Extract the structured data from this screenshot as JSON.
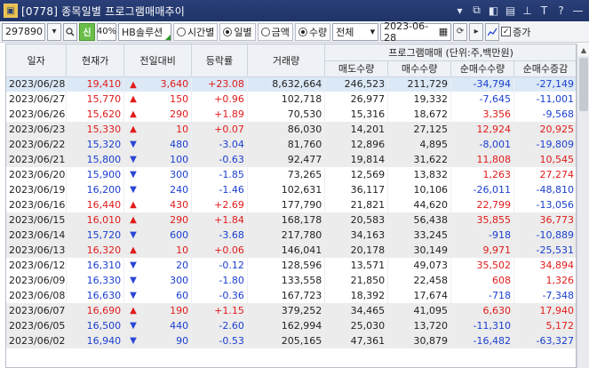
{
  "window": {
    "screen_no": "0778",
    "title": "종목일별 프로그램매매추이"
  },
  "toolbar": {
    "code": "297890",
    "sin_label": "신",
    "margin_rate": "40%",
    "stock_name": "HB솔루션",
    "time_label": "시간별",
    "daily_label": "일별",
    "amount_label": "금액",
    "quantity_label": "수량",
    "market_select": "전체",
    "date": "2023-06-28",
    "chart_label": "",
    "increase_label": "증가"
  },
  "table": {
    "headers": {
      "date": "일자",
      "price": "현재가",
      "prev_diff": "전일대비",
      "rate": "등락률",
      "volume": "거래량",
      "program_group": "프로그램매매  (단위:주,백만원)",
      "sell": "매도수량",
      "buy": "매수수량",
      "net": "순매수수량",
      "net_diff": "순매수증감"
    },
    "rows": [
      {
        "date": "2023/06/28",
        "price": "19,410",
        "dir": "up",
        "diff": "3,640",
        "rate": "+23.08",
        "volume": "8,632,664",
        "sell": "246,523",
        "buy": "211,729",
        "net": "-34,794",
        "net_diff": "-27,149"
      },
      {
        "date": "2023/06/27",
        "price": "15,770",
        "dir": "up",
        "diff": "150",
        "rate": "+0.96",
        "volume": "102,718",
        "sell": "26,977",
        "buy": "19,332",
        "net": "-7,645",
        "net_diff": "-11,001"
      },
      {
        "date": "2023/06/26",
        "price": "15,620",
        "dir": "up",
        "diff": "290",
        "rate": "+1.89",
        "volume": "70,530",
        "sell": "15,316",
        "buy": "18,672",
        "net": "3,356",
        "net_diff": "-9,568"
      },
      {
        "date": "2023/06/23",
        "price": "15,330",
        "dir": "up",
        "diff": "10",
        "rate": "+0.07",
        "volume": "86,030",
        "sell": "14,201",
        "buy": "27,125",
        "net": "12,924",
        "net_diff": "20,925"
      },
      {
        "date": "2023/06/22",
        "price": "15,320",
        "dir": "down",
        "diff": "480",
        "rate": "-3.04",
        "volume": "81,760",
        "sell": "12,896",
        "buy": "4,895",
        "net": "-8,001",
        "net_diff": "-19,809"
      },
      {
        "date": "2023/06/21",
        "price": "15,800",
        "dir": "down",
        "diff": "100",
        "rate": "-0.63",
        "volume": "92,477",
        "sell": "19,814",
        "buy": "31,622",
        "net": "11,808",
        "net_diff": "10,545"
      },
      {
        "date": "2023/06/20",
        "price": "15,900",
        "dir": "down",
        "diff": "300",
        "rate": "-1.85",
        "volume": "73,265",
        "sell": "12,569",
        "buy": "13,832",
        "net": "1,263",
        "net_diff": "27,274"
      },
      {
        "date": "2023/06/19",
        "price": "16,200",
        "dir": "down",
        "diff": "240",
        "rate": "-1.46",
        "volume": "102,631",
        "sell": "36,117",
        "buy": "10,106",
        "net": "-26,011",
        "net_diff": "-48,810"
      },
      {
        "date": "2023/06/16",
        "price": "16,440",
        "dir": "up",
        "diff": "430",
        "rate": "+2.69",
        "volume": "177,790",
        "sell": "21,821",
        "buy": "44,620",
        "net": "22,799",
        "net_diff": "-13,056"
      },
      {
        "date": "2023/06/15",
        "price": "16,010",
        "dir": "up",
        "diff": "290",
        "rate": "+1.84",
        "volume": "168,178",
        "sell": "20,583",
        "buy": "56,438",
        "net": "35,855",
        "net_diff": "36,773"
      },
      {
        "date": "2023/06/14",
        "price": "15,720",
        "dir": "down",
        "diff": "600",
        "rate": "-3.68",
        "volume": "217,780",
        "sell": "34,163",
        "buy": "33,245",
        "net": "-918",
        "net_diff": "-10,889"
      },
      {
        "date": "2023/06/13",
        "price": "16,320",
        "dir": "up",
        "diff": "10",
        "rate": "+0.06",
        "volume": "146,041",
        "sell": "20,178",
        "buy": "30,149",
        "net": "9,971",
        "net_diff": "-25,531"
      },
      {
        "date": "2023/06/12",
        "price": "16,310",
        "dir": "down",
        "diff": "20",
        "rate": "-0.12",
        "volume": "128,596",
        "sell": "13,571",
        "buy": "49,073",
        "net": "35,502",
        "net_diff": "34,894"
      },
      {
        "date": "2023/06/09",
        "price": "16,330",
        "dir": "down",
        "diff": "300",
        "rate": "-1.80",
        "volume": "133,558",
        "sell": "21,850",
        "buy": "22,458",
        "net": "608",
        "net_diff": "1,326"
      },
      {
        "date": "2023/06/08",
        "price": "16,630",
        "dir": "down",
        "diff": "60",
        "rate": "-0.36",
        "volume": "167,723",
        "sell": "18,392",
        "buy": "17,674",
        "net": "-718",
        "net_diff": "-7,348"
      },
      {
        "date": "2023/06/07",
        "price": "16,690",
        "dir": "up",
        "diff": "190",
        "rate": "+1.15",
        "volume": "379,252",
        "sell": "34,465",
        "buy": "41,095",
        "net": "6,630",
        "net_diff": "17,940"
      },
      {
        "date": "2023/06/05",
        "price": "16,500",
        "dir": "down",
        "diff": "440",
        "rate": "-2.60",
        "volume": "162,994",
        "sell": "25,030",
        "buy": "13,720",
        "net": "-11,310",
        "net_diff": "5,172"
      },
      {
        "date": "2023/06/02",
        "price": "16,940",
        "dir": "down",
        "diff": "90",
        "rate": "-0.53",
        "volume": "205,165",
        "sell": "47,361",
        "buy": "30,879",
        "net": "-16,482",
        "net_diff": "-63,327"
      }
    ]
  },
  "colors": {
    "up": "#e11b1b",
    "down": "#1a3fd0",
    "highlight_row": "#dbe8f6",
    "band_row": "#ececec",
    "title_bar": "#1f3468"
  },
  "icons": {
    "search": "search-icon",
    "link": "link-icon",
    "refresh": "refresh-icon",
    "next": "next-icon",
    "chart": "chart-icon"
  }
}
